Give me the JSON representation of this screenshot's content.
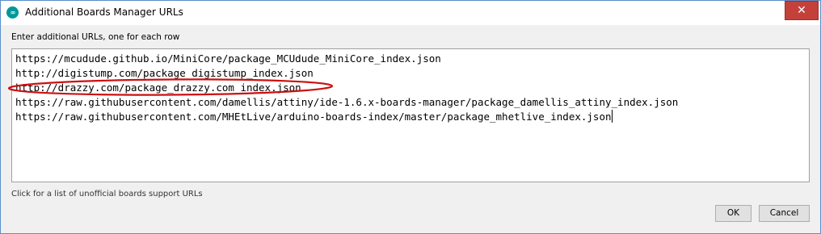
{
  "window": {
    "title": "Additional Boards Manager URLs",
    "app_icon_glyph": "∞",
    "close_glyph": "✕"
  },
  "prompt_label": "Enter additional URLs, one for each row",
  "urls": [
    "https://mcudude.github.io/MiniCore/package_MCUdude_MiniCore_index.json",
    "http://digistump.com/package_digistump_index.json",
    "http://drazzy.com/package_drazzy.com_index.json",
    "https://raw.githubusercontent.com/damellis/attiny/ide-1.6.x-boards-manager/package_damellis_attiny_index.json",
    "https://raw.githubusercontent.com/MHEtLive/arduino-boards-index/master/package_mhetlive_index.json"
  ],
  "highlighted_url_index": 2,
  "help_link_text": "Click for a list of unofficial boards support URLs",
  "buttons": {
    "ok_label": "OK",
    "cancel_label": "Cancel"
  },
  "colors": {
    "highlight_ellipse": "#cc1010",
    "close_button": "#c4413a",
    "app_icon": "#00979c"
  },
  "icons": {
    "app": "arduino-infinity-icon",
    "close": "close-icon"
  }
}
